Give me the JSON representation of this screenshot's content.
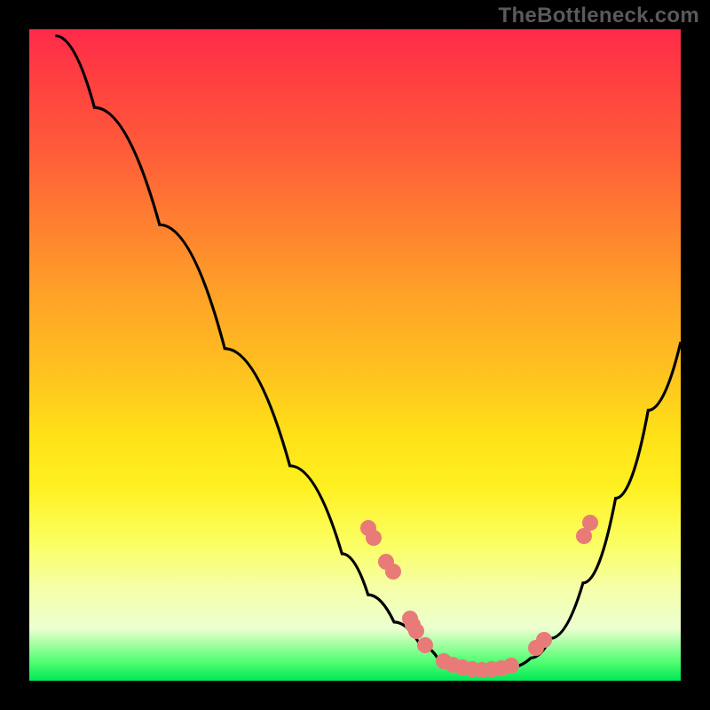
{
  "watermark": "TheBottleneck.com",
  "colors": {
    "page_bg": "#000000",
    "gradient_top": "#ff2a4a",
    "gradient_bottom": "#00e858",
    "curve": "#000000",
    "marker": "#e87b77"
  },
  "chart_data": {
    "type": "line",
    "title": "",
    "xlabel": "",
    "ylabel": "",
    "xlim": [
      0,
      100
    ],
    "ylim": [
      0,
      100
    ],
    "grid": false,
    "legend": false,
    "curve_points": [
      {
        "x": 4.0,
        "y": 99.0
      },
      {
        "x": 10.0,
        "y": 88.0
      },
      {
        "x": 20.0,
        "y": 70.0
      },
      {
        "x": 30.0,
        "y": 51.0
      },
      {
        "x": 40.0,
        "y": 33.0
      },
      {
        "x": 48.0,
        "y": 19.5
      },
      {
        "x": 52.0,
        "y": 13.2
      },
      {
        "x": 56.0,
        "y": 9.0
      },
      {
        "x": 60.0,
        "y": 5.5
      },
      {
        "x": 63.0,
        "y": 3.0
      },
      {
        "x": 66.0,
        "y": 2.0
      },
      {
        "x": 70.0,
        "y": 1.7
      },
      {
        "x": 74.0,
        "y": 2.1
      },
      {
        "x": 77.0,
        "y": 3.5
      },
      {
        "x": 80.0,
        "y": 6.5
      },
      {
        "x": 85.0,
        "y": 15.0
      },
      {
        "x": 90.0,
        "y": 28.0
      },
      {
        "x": 95.0,
        "y": 41.5
      },
      {
        "x": 100.0,
        "y": 52.0
      }
    ],
    "markers": [
      {
        "x": 52.0,
        "y": 23.5
      },
      {
        "x": 52.8,
        "y": 22.0
      },
      {
        "x": 54.8,
        "y": 18.3
      },
      {
        "x": 55.8,
        "y": 16.8
      },
      {
        "x": 58.5,
        "y": 9.6
      },
      {
        "x": 58.9,
        "y": 8.6
      },
      {
        "x": 59.4,
        "y": 7.7
      },
      {
        "x": 60.8,
        "y": 5.4
      },
      {
        "x": 63.6,
        "y": 3.0
      },
      {
        "x": 65.0,
        "y": 2.5
      },
      {
        "x": 66.5,
        "y": 2.1
      },
      {
        "x": 68.0,
        "y": 1.8
      },
      {
        "x": 69.5,
        "y": 1.7
      },
      {
        "x": 71.0,
        "y": 1.8
      },
      {
        "x": 72.5,
        "y": 1.9
      },
      {
        "x": 74.0,
        "y": 2.3
      },
      {
        "x": 77.8,
        "y": 5.0
      },
      {
        "x": 79.0,
        "y": 6.3
      },
      {
        "x": 85.2,
        "y": 22.2
      },
      {
        "x": 86.1,
        "y": 24.3
      }
    ]
  }
}
